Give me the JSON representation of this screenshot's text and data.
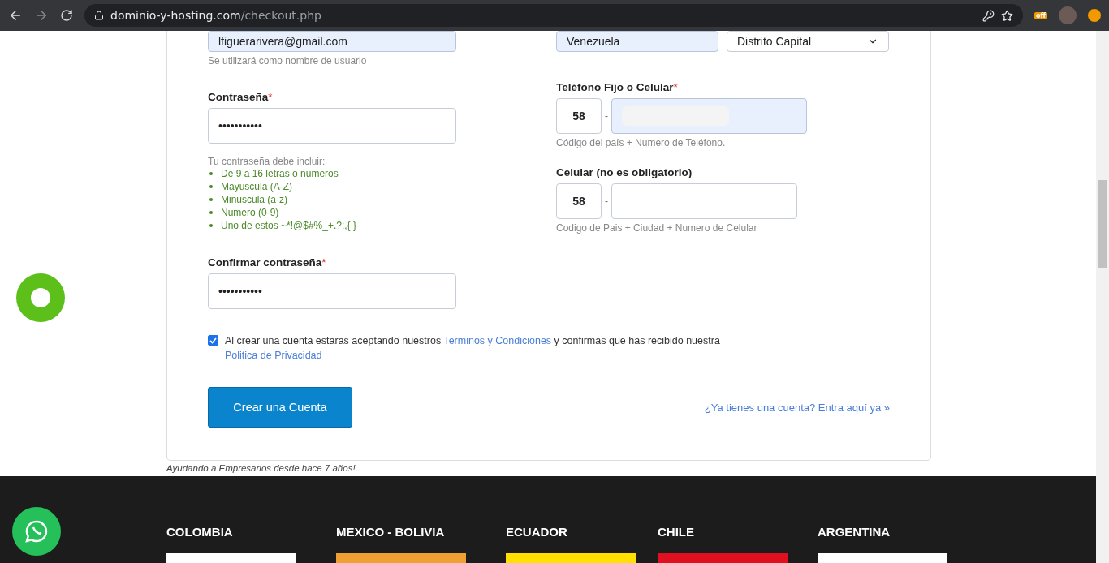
{
  "browser": {
    "url_host": "dominio-y-hosting.com",
    "url_path": "/checkout.php",
    "extension_badge": "off"
  },
  "left_column": {
    "email": {
      "value": "lfiguerarivera@gmail.com",
      "help": "Se utilizará como nombre de usuario"
    },
    "password": {
      "label": "Contraseña",
      "required_mark": "*",
      "value": "•••••••••••"
    },
    "rules_title": "Tu contraseña debe incluir:",
    "rules": [
      "De 9 a 16 letras o numeros",
      "Mayuscula (A-Z)",
      "Minuscula (a-z)",
      "Numero (0-9)",
      "Uno de estos ~*!@$#%_+.?:,{ }"
    ],
    "confirm": {
      "label": "Confirmar contraseña",
      "required_mark": "*",
      "value": "•••••••••••"
    }
  },
  "right_column": {
    "country": {
      "value": "Venezuela"
    },
    "state": {
      "value": "Distrito Capital"
    },
    "phone": {
      "label": "Teléfono Fijo o Celular",
      "required_mark": "*",
      "code": "58",
      "separator": "-",
      "redacted": true,
      "help": "Código del país + Numero de Teléfono."
    },
    "mobile": {
      "label": "Celular (no es obligatorio)",
      "code": "58",
      "separator": "-",
      "help": "Codigo de Pais + Ciudad + Numero de Celular"
    }
  },
  "terms": {
    "checked": true,
    "text_before": "Al crear una cuenta estaras aceptando nuestros",
    "link1": "Terminos y Condiciones",
    "text_middle": "y confirmas que has recibido nuestra",
    "link2": "Politica de Privacidad"
  },
  "submit": "Crear una Cuenta",
  "login_link": "¿Ya tienes una cuenta? Entra aquí ya »",
  "tagline": "Ayudando a Empresarios desde hace 7 años!.",
  "footer": [
    {
      "country": "COLOMBIA",
      "color": "#ffffff"
    },
    {
      "country": "MEXICO - BOLIVIA",
      "color": "#f0a030"
    },
    {
      "country": "ECUADOR",
      "color": "#ffe000"
    },
    {
      "country": "CHILE",
      "color": "#e01020"
    },
    {
      "country": "ARGENTINA",
      "color": "#ffffff"
    }
  ]
}
